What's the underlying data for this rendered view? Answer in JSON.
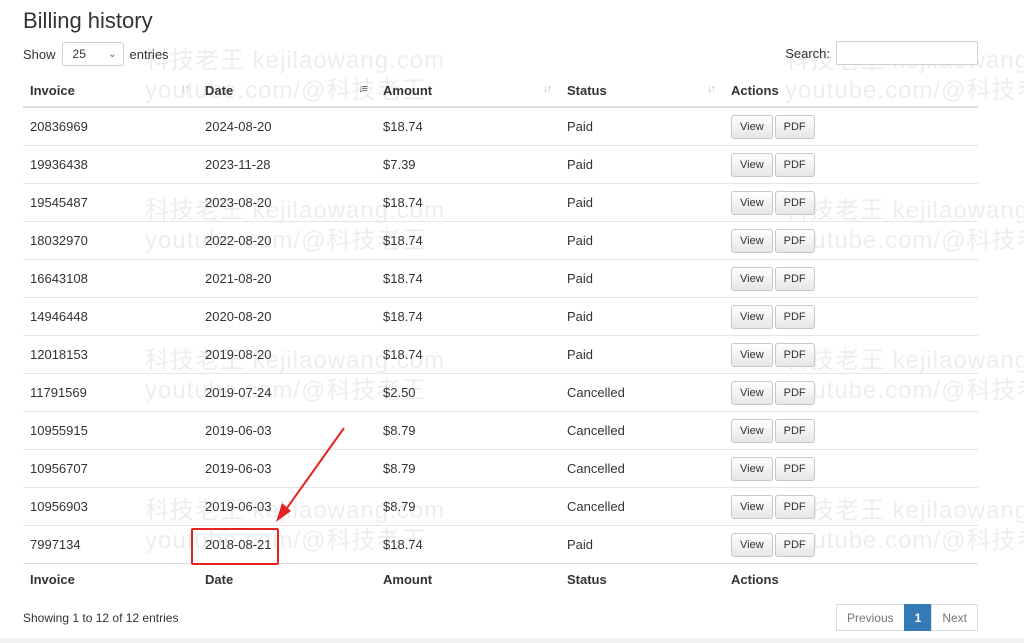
{
  "page": {
    "title": "Billing history"
  },
  "length_menu": {
    "show_label": "Show",
    "value": "25",
    "entries_label": "entries"
  },
  "search": {
    "label": "Search:",
    "value": ""
  },
  "table": {
    "columns": [
      "Invoice",
      "Date",
      "Amount",
      "Status",
      "Actions"
    ],
    "rows": [
      {
        "invoice": "20836969",
        "date": "2024-08-20",
        "amount": "$18.74",
        "status": "Paid",
        "view": "View",
        "pdf": "PDF"
      },
      {
        "invoice": "19936438",
        "date": "2023-11-28",
        "amount": "$7.39",
        "status": "Paid",
        "view": "View",
        "pdf": "PDF"
      },
      {
        "invoice": "19545487",
        "date": "2023-08-20",
        "amount": "$18.74",
        "status": "Paid",
        "view": "View",
        "pdf": "PDF"
      },
      {
        "invoice": "18032970",
        "date": "2022-08-20",
        "amount": "$18.74",
        "status": "Paid",
        "view": "View",
        "pdf": "PDF"
      },
      {
        "invoice": "16643108",
        "date": "2021-08-20",
        "amount": "$18.74",
        "status": "Paid",
        "view": "View",
        "pdf": "PDF"
      },
      {
        "invoice": "14946448",
        "date": "2020-08-20",
        "amount": "$18.74",
        "status": "Paid",
        "view": "View",
        "pdf": "PDF"
      },
      {
        "invoice": "12018153",
        "date": "2019-08-20",
        "amount": "$18.74",
        "status": "Paid",
        "view": "View",
        "pdf": "PDF"
      },
      {
        "invoice": "11791569",
        "date": "2019-07-24",
        "amount": "$2.50",
        "status": "Cancelled",
        "view": "View",
        "pdf": "PDF"
      },
      {
        "invoice": "10955915",
        "date": "2019-06-03",
        "amount": "$8.79",
        "status": "Cancelled",
        "view": "View",
        "pdf": "PDF"
      },
      {
        "invoice": "10956707",
        "date": "2019-06-03",
        "amount": "$8.79",
        "status": "Cancelled",
        "view": "View",
        "pdf": "PDF"
      },
      {
        "invoice": "10956903",
        "date": "2019-06-03",
        "amount": "$8.79",
        "status": "Cancelled",
        "view": "View",
        "pdf": "PDF"
      },
      {
        "invoice": "7997134",
        "date": "2018-08-21",
        "amount": "$18.74",
        "status": "Paid",
        "view": "View",
        "pdf": "PDF"
      }
    ]
  },
  "footer": {
    "info": "Showing 1 to 12 of 12 entries"
  },
  "pagination": {
    "previous": "Previous",
    "current": "1",
    "next": "Next"
  },
  "annotation": {
    "color": "#e52323"
  },
  "watermarks": [
    "科技老王 kejilaowang.com",
    "youtube.com/@科技老王"
  ]
}
